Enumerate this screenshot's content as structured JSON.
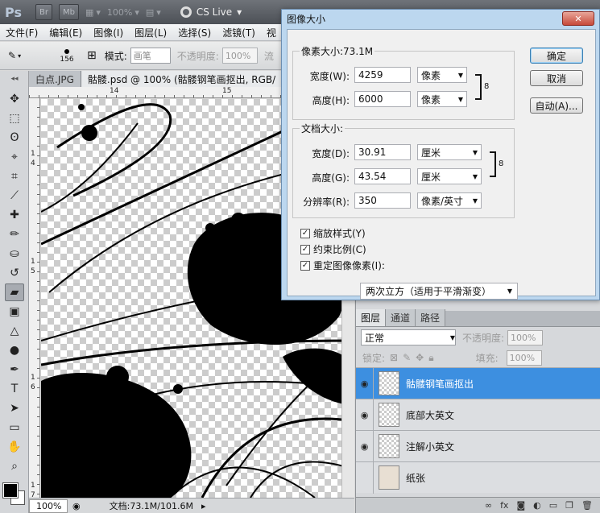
{
  "appbar": {
    "logo": "Ps",
    "btn_bridge": "Br",
    "btn_minibridge": "Mb",
    "zoom": "100%",
    "cs_live": "CS Live"
  },
  "menu": [
    "文件(F)",
    "编辑(E)",
    "图像(I)",
    "图层(L)",
    "选择(S)",
    "滤镜(T)",
    "视"
  ],
  "options": {
    "brush_size": "156",
    "mode_label": "模式:",
    "mode_value": "画笔",
    "opacity_label": "不透明度:",
    "opacity_value": "100%",
    "flow_label": "流"
  },
  "tabs": [
    "白点.JPG",
    "骷髅.psd @ 100% (骷髅钢笔画抠出, RGB/"
  ],
  "ruler": {
    "h": [
      "14",
      "15"
    ],
    "v": [
      "1",
      "4",
      "1",
      "5",
      "1",
      "6",
      "1",
      "7"
    ]
  },
  "status": {
    "zoom": "100%",
    "doc": "文档:73.1M/101.6M"
  },
  "dialog": {
    "title": "图像大小",
    "close": "✕",
    "pixel_dims": "像素大小:73.1M",
    "width_label": "宽度(W):",
    "width_value": "4259",
    "width_unit": "像素",
    "height_label": "高度(H):",
    "height_value": "6000",
    "height_unit": "像素",
    "doc_size": "文档大小:",
    "doc_width_label": "宽度(D):",
    "doc_width_value": "30.91",
    "doc_width_unit": "厘米",
    "doc_height_label": "高度(G):",
    "doc_height_value": "43.54",
    "doc_height_unit": "厘米",
    "res_label": "分辨率(R):",
    "res_value": "350",
    "res_unit": "像素/英寸",
    "scale_styles": "缩放样式(Y)",
    "constrain": "约束比例(C)",
    "resample": "重定图像像素(I):",
    "resample_method": "两次立方（适用于平滑渐变）",
    "ok": "确定",
    "cancel": "取消",
    "auto": "自动(A)..."
  },
  "layers_panel": {
    "tabs": [
      "图层",
      "通道",
      "路径"
    ],
    "blend_mode": "正常",
    "opacity_label": "不透明度:",
    "opacity_value": "100%",
    "lock_label": "锁定:",
    "fill_label": "填充:",
    "fill_value": "100%",
    "layers": [
      {
        "name": "骷髅钢笔画抠出",
        "visible": true,
        "selected": true
      },
      {
        "name": "底部大英文",
        "visible": true,
        "selected": false
      },
      {
        "name": "注解小英文",
        "visible": true,
        "selected": false
      },
      {
        "name": "纸张",
        "visible": false,
        "selected": false
      }
    ],
    "footer": [
      "∞",
      "fx"
    ]
  }
}
